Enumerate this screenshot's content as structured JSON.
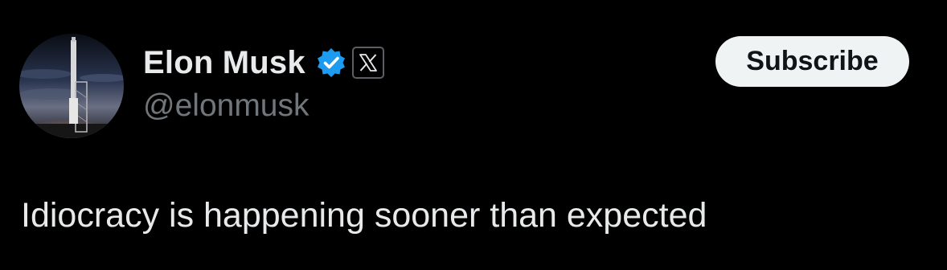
{
  "author": {
    "display_name": "Elon Musk",
    "handle": "@elonmusk",
    "avatar_icon": "rocket-launch-photo",
    "verified_icon": "verified-badge-icon",
    "affiliation_icon": "x-logo-icon"
  },
  "actions": {
    "subscribe_label": "Subscribe"
  },
  "tweet": {
    "text": "Idiocracy is happening sooner than expected"
  },
  "colors": {
    "background": "#000000",
    "name": "#e9eaeb",
    "handle": "#71767b",
    "text": "#e7e9ea",
    "verified": "#1d9bf0",
    "subscribe_bg": "#eff3f4",
    "subscribe_text": "#0f1419"
  }
}
